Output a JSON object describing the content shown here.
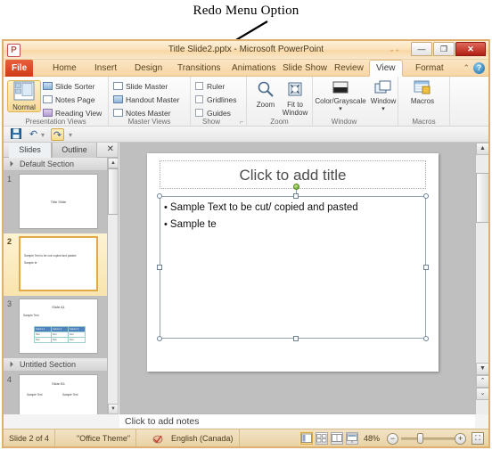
{
  "annotation": {
    "label": "Redo Menu Option"
  },
  "window": {
    "logo": "P",
    "title": "Title Slide2.pptx  -  Microsoft PowerPoint",
    "minimize_label": "—",
    "maximize_label": "❐",
    "close_label": "✕"
  },
  "ribbon": {
    "tabs": [
      {
        "label": "File",
        "type": "file"
      },
      {
        "label": "Home",
        "type": "normal"
      },
      {
        "label": "Insert",
        "type": "normal"
      },
      {
        "label": "Design",
        "type": "normal"
      },
      {
        "label": "Transitions",
        "type": "normal"
      },
      {
        "label": "Animations",
        "type": "normal"
      },
      {
        "label": "Slide Show",
        "type": "normal"
      },
      {
        "label": "Review",
        "type": "normal"
      },
      {
        "label": "View",
        "type": "active"
      },
      {
        "label": "Format",
        "type": "normal"
      }
    ],
    "help_icon": "?",
    "minimize_ribbon_icon": "⌃",
    "groups": [
      {
        "name": "Presentation Views",
        "big_button": "Normal",
        "items": [
          "Slide Sorter",
          "Notes Page",
          "Reading View"
        ]
      },
      {
        "name": "Master Views",
        "items": [
          "Slide Master",
          "Handout Master",
          "Notes Master"
        ]
      },
      {
        "name": "Show",
        "items": [
          "Ruler",
          "Gridlines",
          "Guides"
        ],
        "dialog_launcher": "⌐"
      },
      {
        "name": "Zoom",
        "items": [
          "Zoom",
          "Fit to Window"
        ]
      },
      {
        "name": "Window",
        "items": [
          "Color/Grayscale",
          "Window"
        ]
      },
      {
        "name": "Macros",
        "items": [
          "Macros"
        ]
      }
    ]
  },
  "quick_access": {
    "save_icon": "💾",
    "undo_icon": "↶",
    "undo_dropdown_icon": "▾",
    "redo_icon": "↷",
    "customize_icon": "▾"
  },
  "left_pane": {
    "tabs": [
      {
        "label": "Slides",
        "active": true
      },
      {
        "label": "Outline",
        "active": false
      }
    ],
    "close_icon": "✕",
    "sections": [
      {
        "name": "Default Section",
        "slides": [
          {
            "number": "1",
            "title": "Title Slide",
            "selected": false,
            "kind": "title"
          },
          {
            "number": "2",
            "title": "",
            "selected": true,
            "kind": "bullets",
            "bullets": [
              "Sample Text to be cut/ copied and pasted",
              "Sample te"
            ]
          }
        ]
      },
      {
        "name": "Untitled Section",
        "slides": [
          {
            "number": "3",
            "title": "Slide A1",
            "selected": false,
            "kind": "table",
            "bullets": [
              "Sample Text"
            ],
            "table_headers": [
              "Column 1",
              "Column 2",
              "Column 3"
            ],
            "table_rows": [
              [
                "Text",
                "Text",
                "Text"
              ],
              [
                "Text",
                "Text",
                "Text"
              ]
            ]
          },
          {
            "number": "4",
            "title": "Slide B1",
            "selected": false,
            "kind": "two-column",
            "bullets": [
              "Sample Text",
              "Sample Text"
            ]
          }
        ]
      }
    ],
    "scroll_up_icon": "▲",
    "scroll_down_icon": "▼"
  },
  "slide": {
    "title_placeholder": "Click to add title",
    "body_bullets": [
      "Sample Text to be cut/ copied and pasted",
      "Sample te"
    ]
  },
  "notes": {
    "placeholder": "Click to add notes"
  },
  "scrollbar": {
    "up_icon": "▲",
    "down_icon": "▼",
    "prev_slide_icon": "⌃",
    "next_slide_icon": "⌄",
    "double_up_icon": "⌃"
  },
  "status_bar": {
    "slide_counter": "Slide 2 of 4",
    "theme": "\"Office Theme\"",
    "language": "English (Canada)",
    "spellcheck_icon": "spell-check-icon",
    "views": [
      {
        "name": "normal-view-button",
        "active": true
      },
      {
        "name": "slide-sorter-view-button",
        "active": false
      },
      {
        "name": "reading-view-button",
        "active": false
      },
      {
        "name": "slide-show-button",
        "active": false
      }
    ],
    "zoom_level": "48%",
    "zoom_out_icon": "−",
    "zoom_in_icon": "+",
    "fit_window_icon": "⛶"
  },
  "colors": {
    "accent": "#e0b070",
    "file_tab": "#cf3a18",
    "selection": "#e3a948",
    "canvas_bg": "#bfbfbf"
  }
}
